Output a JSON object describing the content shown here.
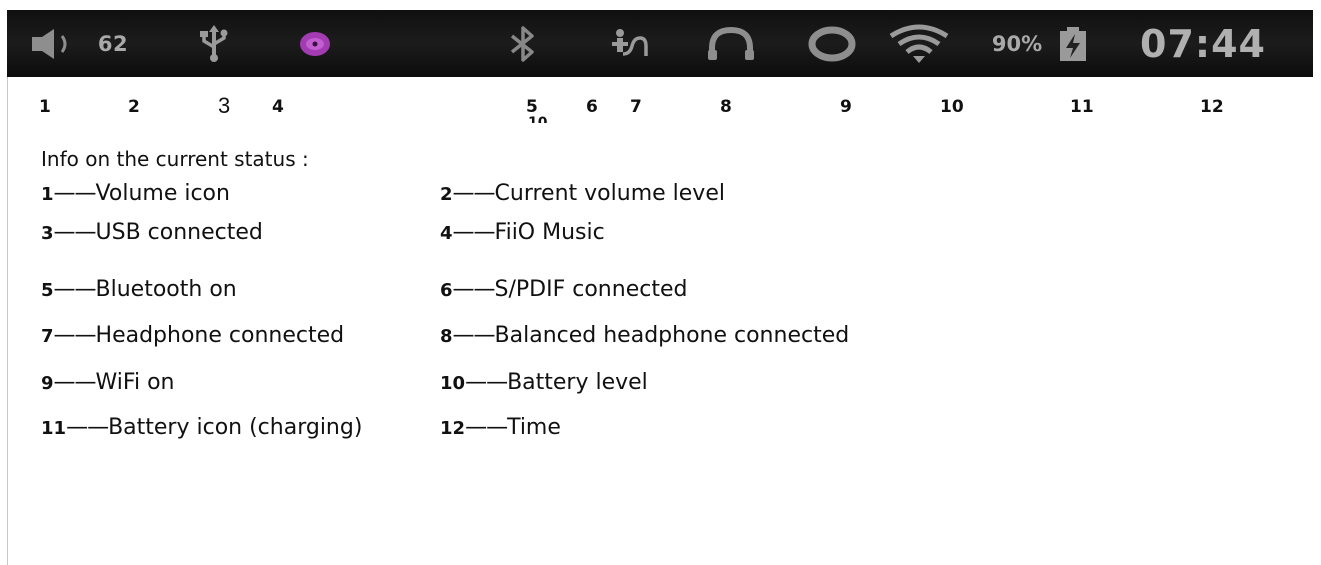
{
  "status_bar": {
    "volume_level": "62",
    "battery_level": "90%",
    "time": "07:44",
    "icons": [
      "volume-icon",
      "usb-icon",
      "fiio-music-icon",
      "bluetooth-icon",
      "spdif-icon",
      "headphone-icon",
      "balanced-headphone-icon",
      "wifi-icon",
      "battery-charging-icon"
    ],
    "colors": {
      "background": "#141414",
      "icon_gray": "#9a9a9a",
      "music_purple": "#a33bb3"
    }
  },
  "markers": [
    "1",
    "2",
    "3",
    "4",
    "5",
    "6",
    "7",
    "8",
    "9",
    "10",
    "11",
    "12"
  ],
  "info_title": "Info on the current status :",
  "legend": [
    {
      "num": "1",
      "label": "Volume icon"
    },
    {
      "num": "2",
      "label": "Current volume level"
    },
    {
      "num": "3",
      "label": "USB connected"
    },
    {
      "num": "4",
      "label": "FiiO Music"
    },
    {
      "num": "5",
      "label": "Bluetooth on"
    },
    {
      "num": "6",
      "label": "S/PDIF connected"
    },
    {
      "num": "7",
      "label": "Headphone connected"
    },
    {
      "num": "8",
      "label": "Balanced headphone connected"
    },
    {
      "num": "9",
      "label": "WiFi on"
    },
    {
      "num": "10",
      "label": "Battery level"
    },
    {
      "num": "11",
      "label": "Battery icon (charging)"
    },
    {
      "num": "12",
      "label": "Time"
    }
  ]
}
